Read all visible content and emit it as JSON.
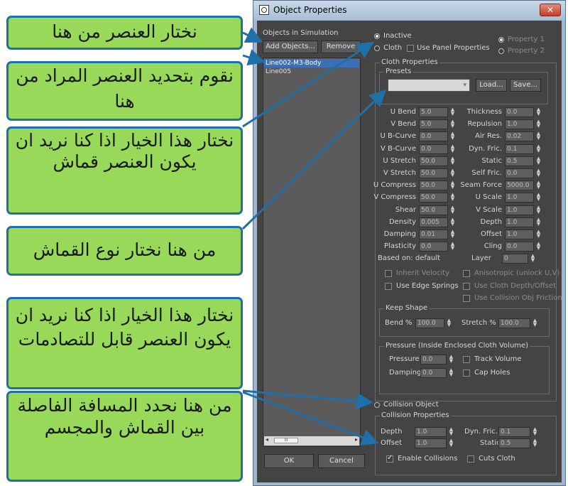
{
  "window": {
    "title": "Object Properties",
    "close_glyph": "✕"
  },
  "left_panel": {
    "label": "Objects in Simulation",
    "add_button": "Add Objects...",
    "remove_button": "Remove",
    "items": [
      {
        "label": "Line002-M3-Body",
        "selected": true
      },
      {
        "label": "Line005",
        "selected": false
      }
    ],
    "scroll_thumb": "III",
    "ok_button": "OK",
    "cancel_button": "Cancel"
  },
  "mode": {
    "inactive": "Inactive",
    "cloth": "Cloth",
    "use_panel": "Use Panel Properties",
    "property1": "Property 1",
    "property2": "Property 2"
  },
  "cloth_properties": {
    "label": "Cloth Properties",
    "presets_label": "Presets",
    "load_button": "Load...",
    "save_button": "Save...",
    "left_fields": [
      {
        "label": "U Bend",
        "value": "5.0"
      },
      {
        "label": "V Bend",
        "value": "5.0"
      },
      {
        "label": "U B-Curve",
        "value": "0.0"
      },
      {
        "label": "V B-Curve",
        "value": "0.0"
      },
      {
        "label": "U Stretch",
        "value": "50.0"
      },
      {
        "label": "V Stretch",
        "value": "50.0"
      },
      {
        "label": "U Compress",
        "value": "50.0"
      },
      {
        "label": "V Compress",
        "value": "50.0"
      },
      {
        "label": "Shear",
        "value": "50.0"
      },
      {
        "label": "Density",
        "value": "0.005"
      },
      {
        "label": "Damping",
        "value": "0.01"
      },
      {
        "label": "Plasticity",
        "value": "0.0"
      }
    ],
    "right_fields": [
      {
        "label": "Thickness",
        "value": "0.0"
      },
      {
        "label": "Repulsion",
        "value": "1.0"
      },
      {
        "label": "Air Res.",
        "value": "0.02"
      },
      {
        "label": "Dyn. Fric.",
        "value": "0.1"
      },
      {
        "label": "Static",
        "value": "0.5"
      },
      {
        "label": "Self Fric.",
        "value": "0.0"
      },
      {
        "label": "Seam Force",
        "value": "5000.0"
      },
      {
        "label": "U Scale",
        "value": "1.0"
      },
      {
        "label": "V Scale",
        "value": "1.0"
      },
      {
        "label": "Depth",
        "value": "1.0"
      },
      {
        "label": "Offset",
        "value": "1.0"
      },
      {
        "label": "Cling",
        "value": "0.0"
      }
    ],
    "based_on": "Based on: default",
    "layer_label": "Layer",
    "layer_value": "0",
    "inherit_velocity": "Inherit Velocity",
    "anisotropic": "Anisotropic (unlock U,V)",
    "use_edge_springs": "Use Edge Springs",
    "use_cloth_depth": "Use Cloth Depth/Offset",
    "use_collision_friction": "Use Collision Obj Friction"
  },
  "keep_shape": {
    "label": "Keep Shape",
    "bend_label": "Bend %",
    "bend_value": "100.0",
    "stretch_label": "Stretch %",
    "stretch_value": "100.0"
  },
  "pressure": {
    "label": "Pressure (Inside Enclosed Cloth Volume)",
    "pressure_label": "Pressure",
    "pressure_value": "0.0",
    "track_volume": "Track Volume",
    "damping_label": "Damping",
    "damping_value": "0.0",
    "cap_holes": "Cap Holes"
  },
  "collision": {
    "object_label": "Collision Object",
    "properties_label": "Collision Properties",
    "depth_label": "Depth",
    "depth_value": "1.0",
    "offset_label": "Offset",
    "offset_value": "1.0",
    "dyn_fric_label": "Dyn. Fric.",
    "dyn_fric_value": "0.1",
    "static_label": "Static",
    "static_value": "0.5",
    "enable_collisions": "Enable Collisions",
    "cuts_cloth": "Cuts Cloth"
  },
  "callouts": [
    "نختار العنصر من هنا",
    "نقوم بتحديد العنصر المراد من هنا",
    "نختار هذا الخيار اذا كنا نريد ان يكون العنصر قماش",
    "من هنا نختار نوع القماش",
    "نختار هذا الخيار اذا كنا نريد ان يكون العنصر قابل للتصادمات",
    "من هنا نحدد المسافة الفاصلة بين القماش والمجسم"
  ],
  "colors": {
    "callout_bg": "#98d95a",
    "callout_border": "#1f6fa8",
    "panel_bg": "#444444",
    "selection": "#3d6fb6"
  }
}
